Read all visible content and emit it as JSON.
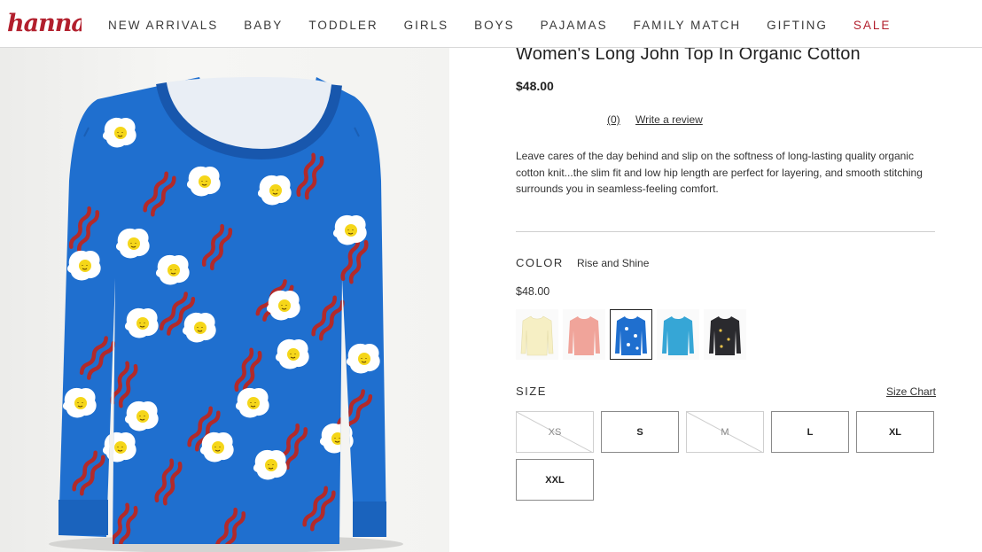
{
  "brand": {
    "logo_text": "hanna",
    "color": "#b21f2d"
  },
  "nav": {
    "items": [
      "NEW ARRIVALS",
      "BABY",
      "TODDLER",
      "GIRLS",
      "BOYS",
      "PAJAMAS",
      "FAMILY MATCH",
      "GIFTING",
      "SALE"
    ],
    "sale_color": "#b21f2d"
  },
  "product": {
    "title": "Women's Long John Top In Organic Cotton",
    "price": "$48.00",
    "review_count": "(0)",
    "write_review": "Write a review",
    "description": "Leave cares of the day behind and slip on the softness of long-lasting quality organic cotton knit...the slim fit and low hip length are perfect for layering, and smooth stitching surrounds you in seamless-feeling comfort.",
    "image_colors": {
      "shirt": "#1f6fcf",
      "egg": "#ffffff",
      "yolk": "#f5d619",
      "bacon": "#b22a2a"
    }
  },
  "color": {
    "label": "COLOR",
    "selected_name": "Rise and Shine",
    "price": "$48.00",
    "swatches": [
      {
        "color": "#f6efc4",
        "selected": false
      },
      {
        "color": "#f0a49a",
        "selected": false
      },
      {
        "color": "#1f6fcf",
        "selected": true
      },
      {
        "color": "#36a6d6",
        "selected": false
      },
      {
        "color": "#2a2a2e",
        "selected": false
      }
    ]
  },
  "size": {
    "label": "SIZE",
    "chart_link": "Size Chart",
    "options": [
      {
        "label": "XS",
        "available": false
      },
      {
        "label": "S",
        "available": true
      },
      {
        "label": "M",
        "available": false
      },
      {
        "label": "L",
        "available": true
      },
      {
        "label": "XL",
        "available": true
      },
      {
        "label": "XXL",
        "available": true
      }
    ]
  }
}
